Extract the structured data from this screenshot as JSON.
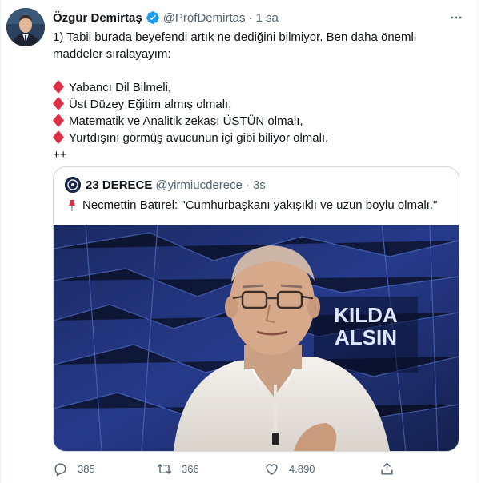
{
  "tweet": {
    "author_name": "Özgür Demirtaş",
    "handle": "@ProfDemirtas",
    "separator": "·",
    "time": "1 sa",
    "intro_line1": "1) Tabii burada beyefendi artık ne dediğini bilmiyor. Ben daha önemli",
    "intro_line2": "maddeler sıralayayım:",
    "items": [
      "Yabancı Dil Bilmeli,",
      "Üst Düzey Eğitim almış olmalı,",
      "Matematik ve Analitik zekası ÜSTÜN olmalı,",
      "Yurtdışını görmüş avucunun içi gibi biliyor olmalı,"
    ],
    "closing": "++"
  },
  "quoted": {
    "author_name": "23 DERECE",
    "handle": "@yirmiucderece",
    "separator": "·",
    "time": "3s",
    "text": "Necmettin Batırel: \"Cumhurbaşkanı yakışıklı ve uzun boylu olmalı.\"",
    "image_overlay_text": [
      "KILDA",
      "ALSIN"
    ]
  },
  "actions": {
    "reply_count": "385",
    "retweet_count": "366",
    "like_count": "4.890"
  },
  "colors": {
    "text": "#0f1419",
    "secondary": "#536471",
    "verified": "#1d9bf0",
    "diamond": "#dd2e44",
    "border": "#cfd9de"
  },
  "icons": [
    "verified-badge-icon",
    "more-icon",
    "diamond-icon",
    "pushpin-icon",
    "reply-icon",
    "retweet-icon",
    "like-icon",
    "share-icon"
  ]
}
